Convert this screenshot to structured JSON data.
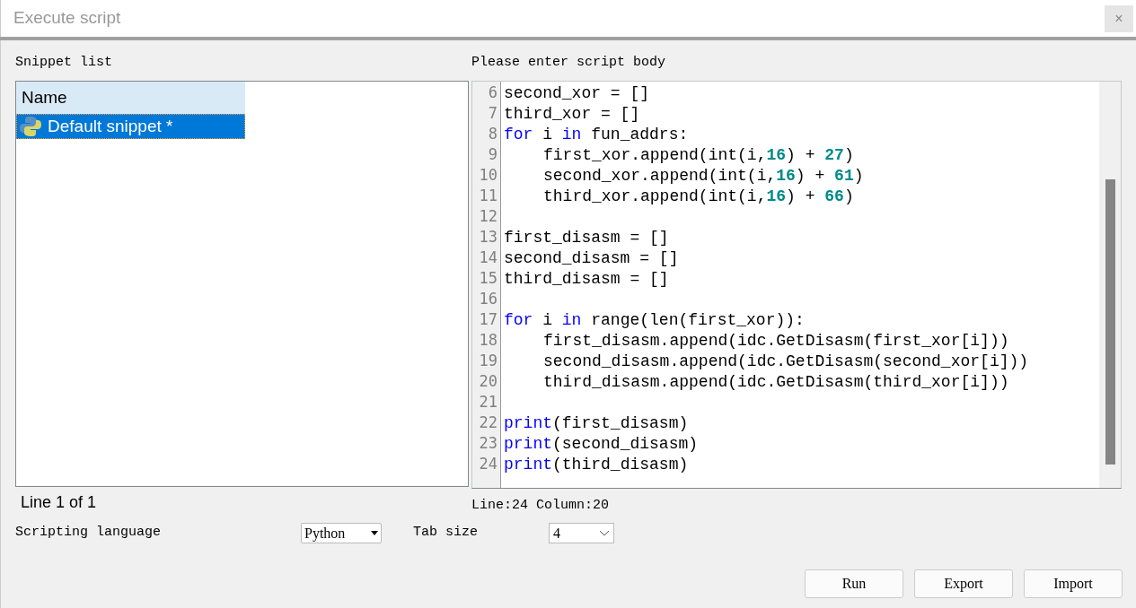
{
  "window": {
    "title": "Execute script",
    "close": "×"
  },
  "snippet_list": {
    "label": "Snippet list",
    "column": "Name",
    "items": [
      {
        "name": "Default snippet *",
        "selected": true
      }
    ],
    "status": "Line 1 of 1"
  },
  "editor": {
    "label": "Please enter script body",
    "status": "Line:24 Column:20",
    "lines": [
      {
        "number": "6",
        "indented": false,
        "tokens": [
          {
            "kind": "plain",
            "text": "second_xor = []"
          }
        ]
      },
      {
        "number": "7",
        "indented": false,
        "tokens": [
          {
            "kind": "plain",
            "text": "third_xor = []"
          }
        ]
      },
      {
        "number": "8",
        "indented": false,
        "tokens": [
          {
            "kind": "keyword",
            "text": "for"
          },
          {
            "kind": "plain",
            "text": " i "
          },
          {
            "kind": "keyword",
            "text": "in"
          },
          {
            "kind": "plain",
            "text": " fun_addrs:"
          }
        ]
      },
      {
        "number": "9",
        "indented": true,
        "tokens": [
          {
            "kind": "plain",
            "text": "first_xor.append(int(i,"
          },
          {
            "kind": "number",
            "text": "16"
          },
          {
            "kind": "plain",
            "text": ") + "
          },
          {
            "kind": "number",
            "text": "27"
          },
          {
            "kind": "plain",
            "text": ")"
          }
        ]
      },
      {
        "number": "10",
        "indented": true,
        "tokens": [
          {
            "kind": "plain",
            "text": "second_xor.append(int(i,"
          },
          {
            "kind": "number",
            "text": "16"
          },
          {
            "kind": "plain",
            "text": ") + "
          },
          {
            "kind": "number",
            "text": "61"
          },
          {
            "kind": "plain",
            "text": ")"
          }
        ]
      },
      {
        "number": "11",
        "indented": true,
        "tokens": [
          {
            "kind": "plain",
            "text": "third_xor.append(int(i,"
          },
          {
            "kind": "number",
            "text": "16"
          },
          {
            "kind": "plain",
            "text": ") + "
          },
          {
            "kind": "number",
            "text": "66"
          },
          {
            "kind": "plain",
            "text": ")"
          }
        ]
      },
      {
        "number": "12"
      },
      {
        "number": "13",
        "indented": false,
        "tokens": [
          {
            "kind": "plain",
            "text": "first_disasm = []"
          }
        ]
      },
      {
        "number": "14",
        "indented": false,
        "tokens": [
          {
            "kind": "plain",
            "text": "second_disasm = []"
          }
        ]
      },
      {
        "number": "15",
        "indented": false,
        "tokens": [
          {
            "kind": "plain",
            "text": "third_disasm = []"
          }
        ]
      },
      {
        "number": "16"
      },
      {
        "number": "17",
        "indented": false,
        "tokens": [
          {
            "kind": "keyword",
            "text": "for"
          },
          {
            "kind": "plain",
            "text": " i "
          },
          {
            "kind": "keyword",
            "text": "in"
          },
          {
            "kind": "plain",
            "text": " range(len(first_xor)):"
          }
        ]
      },
      {
        "number": "18",
        "indented": true,
        "tokens": [
          {
            "kind": "plain",
            "text": "first_disasm.append(idc.GetDisasm(first_xor[i]))"
          }
        ]
      },
      {
        "number": "19",
        "indented": true,
        "tokens": [
          {
            "kind": "plain",
            "text": "second_disasm.append(idc.GetDisasm(second_xor[i]))"
          }
        ]
      },
      {
        "number": "20",
        "indented": true,
        "tokens": [
          {
            "kind": "plain",
            "text": "third_disasm.append(idc.GetDisasm(third_xor[i]))"
          }
        ]
      },
      {
        "number": "21"
      },
      {
        "number": "22",
        "indented": false,
        "tokens": [
          {
            "kind": "keyword",
            "text": "print"
          },
          {
            "kind": "plain",
            "text": "(first_disasm)"
          }
        ]
      },
      {
        "number": "23",
        "indented": false,
        "tokens": [
          {
            "kind": "keyword",
            "text": "print"
          },
          {
            "kind": "plain",
            "text": "(second_disasm)"
          }
        ]
      },
      {
        "number": "24",
        "indented": false,
        "tokens": [
          {
            "kind": "keyword",
            "text": "print"
          },
          {
            "kind": "plain",
            "text": "(third_disasm)"
          }
        ]
      }
    ]
  },
  "scripting_language": {
    "label": "Scripting language",
    "value": "Python"
  },
  "tab_size": {
    "label": "Tab size",
    "value": "4"
  },
  "buttons": [
    "Run",
    "Export",
    "Import"
  ]
}
